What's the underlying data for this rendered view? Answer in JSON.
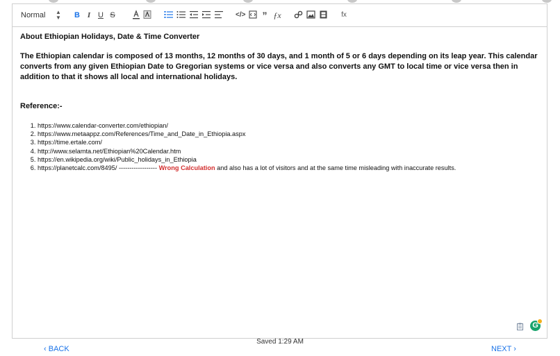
{
  "toolbar": {
    "format_value": "Normal",
    "icons": [
      "bold-icon",
      "italic-icon",
      "underline-icon",
      "strikethrough-icon",
      "text-color-icon",
      "highlight-icon",
      "ordered-list-icon",
      "bullet-list-icon",
      "outdent-icon",
      "indent-icon",
      "align-icon",
      "code-icon",
      "code-block-icon",
      "blockquote-icon",
      "formula-icon",
      "link-icon",
      "image-icon",
      "video-icon",
      "fx-icon"
    ],
    "bold_label": "B",
    "italic_label": "I",
    "underline_label": "U",
    "strike_label": "S",
    "fx_label": "fx",
    "accent": "#1a73e8"
  },
  "content": {
    "title": "About Ethiopian Holidays, Date & Time Converter",
    "intro": "The Ethiopian calendar is composed of 13 months, 12 months of 30 days, and 1 month of 5 or 6 days depending on its leap year. This calendar converts from any given Ethiopian Date to Gregorian systems or vice versa and also converts any GMT to local time or vice versa then in addition to that it shows all local and international holidays.",
    "reference_title": "Reference:-",
    "references": [
      "https://www.calendar-converter.com/ethiopian/",
      "https://www.metaappz.com/References/Time_and_Date_in_Ethiopia.aspx",
      "https://time.ertale.com/",
      "http://www.selamta.net/Ethiopian%20Calendar.htm",
      "https://en.wikipedia.org/wiki/Public_holidays_in_Ethiopia"
    ],
    "last_ref_prefix": "https://planetcalc.com/8495/ ------------------",
    "last_ref_highlight": "Wrong Calculation",
    "last_ref_suffix": "and also has a lot of visitors and at the same time misleading with inaccurate results."
  },
  "footer": {
    "back_label": "BACK",
    "saved_text": "Saved 1:29 AM",
    "next_label": "NEXT"
  }
}
